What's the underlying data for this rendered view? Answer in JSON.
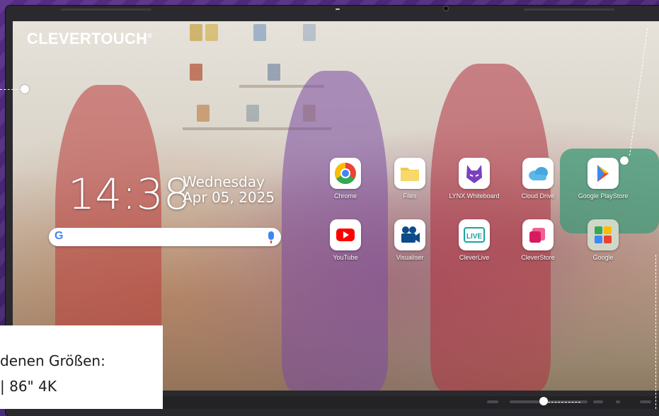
{
  "brand": {
    "logo_text": "CLEVERTOUCH",
    "logo_mark": "®"
  },
  "home": {
    "time": "14:38",
    "day": "Wednesday",
    "date": "Apr 05, 2025",
    "search_glyph": "G"
  },
  "apps": [
    {
      "label": "Chrome",
      "icon": "chrome-icon"
    },
    {
      "label": "Files",
      "icon": "folder-icon"
    },
    {
      "label": "LYNX Whiteboard",
      "icon": "lynx-icon"
    },
    {
      "label": "Cloud Drive",
      "icon": "cloud-icon"
    },
    {
      "label": "Google PlayStore",
      "icon": "play-store-icon"
    },
    {
      "label": "YouTube",
      "icon": "youtube-icon"
    },
    {
      "label": "Visualiser",
      "icon": "camera-icon"
    },
    {
      "label": "CleverLive",
      "icon": "live-icon"
    },
    {
      "label": "CleverStore",
      "icon": "store-icon"
    },
    {
      "label": "Google",
      "icon": "google-apps-icon"
    }
  ],
  "info_box": {
    "line1": "denen Größen:",
    "line2": "| 86\" 4K"
  },
  "colors": {
    "accent": "#4b2a7a",
    "bezel": "#2a2a2e",
    "google_blue": "#4285f4"
  }
}
